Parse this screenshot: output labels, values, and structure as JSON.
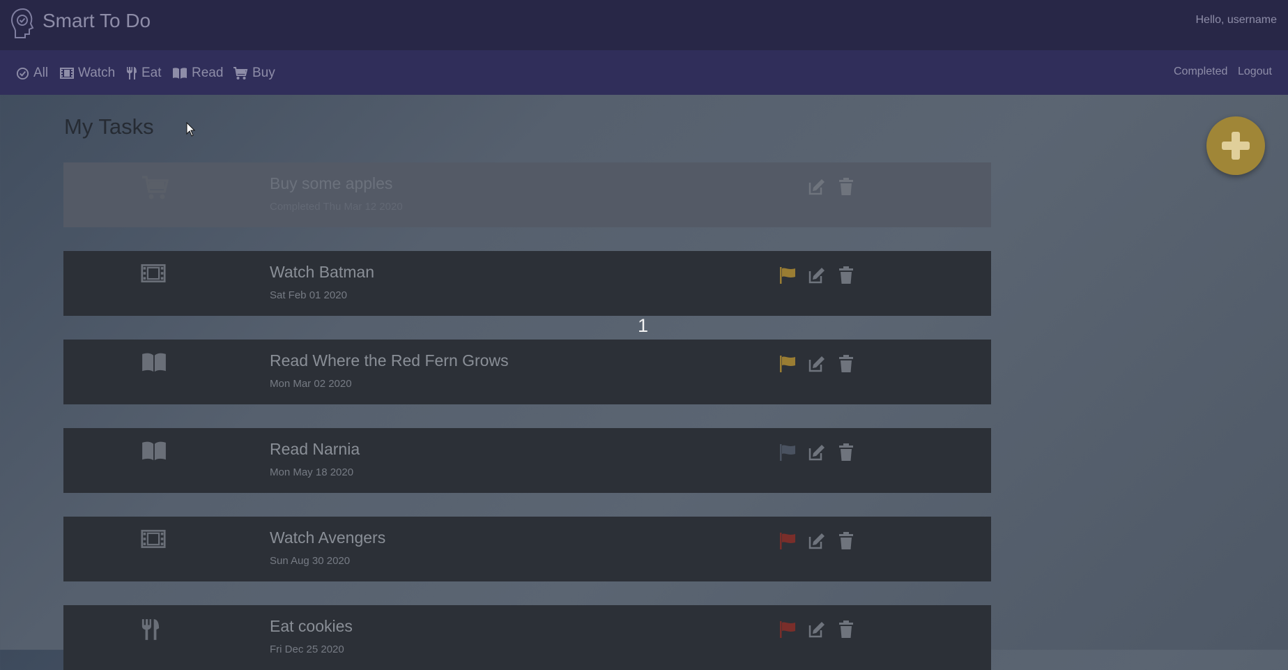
{
  "app": {
    "title": "Smart To Do",
    "greeting": "Hello, username"
  },
  "nav": {
    "items": [
      {
        "label": "All",
        "icon": "check-circle-icon"
      },
      {
        "label": "Watch",
        "icon": "film-icon"
      },
      {
        "label": "Eat",
        "icon": "utensils-icon"
      },
      {
        "label": "Read",
        "icon": "book-icon"
      },
      {
        "label": "Buy",
        "icon": "cart-icon"
      }
    ],
    "completed_label": "Completed",
    "logout_label": "Logout"
  },
  "page": {
    "title": "My Tasks",
    "counter": "1"
  },
  "tasks": [
    {
      "title": "Buy some apples",
      "date": "Completed Thu Mar 12 2020",
      "category": "cart-icon",
      "completed": true,
      "flag": "none"
    },
    {
      "title": "Watch Batman",
      "date": "Sat Feb 01 2020",
      "category": "film-icon",
      "completed": false,
      "flag": "#9a7d33"
    },
    {
      "title": "Read Where the Red Fern Grows",
      "date": "Mon Mar 02 2020",
      "category": "book-icon",
      "completed": false,
      "flag": "#9a7d33"
    },
    {
      "title": "Read Narnia",
      "date": "Mon May 18 2020",
      "category": "book-icon",
      "completed": false,
      "flag": "#4a5260"
    },
    {
      "title": "Watch Avengers",
      "date": "Sun Aug 30 2020",
      "category": "film-icon",
      "completed": false,
      "flag": "#7a2e2a"
    },
    {
      "title": "Eat cookies",
      "date": "Fri Dec 25 2020",
      "category": "utensils-icon",
      "completed": false,
      "flag": "#7a2e2a"
    }
  ],
  "colors": {
    "accent": "#a08637",
    "header": "#282747",
    "navbar": "#302e5a",
    "row": "#2c3037"
  }
}
